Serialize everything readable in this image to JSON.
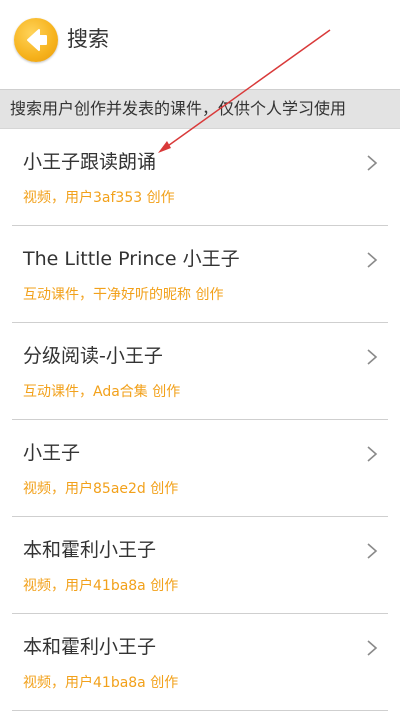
{
  "header": {
    "title": "搜索",
    "back_icon": "back-arrow-icon",
    "accent_color": "#f6b21c"
  },
  "notice": {
    "text": "搜索用户创作并发表的课件，仅供个人学习使用"
  },
  "results": [
    {
      "title": "小王子跟读朗诵",
      "subtitle": "视频，用户3af353 创作"
    },
    {
      "title": "The  Little Prince  小王子",
      "subtitle": "互动课件，干净好听的昵称 创作"
    },
    {
      "title": "分级阅读-小王子",
      "subtitle": "互动课件，Ada合集 创作"
    },
    {
      "title": "小王子",
      "subtitle": "视频，用户85ae2d 创作"
    },
    {
      "title": "本和霍利小王子",
      "subtitle": "视频，用户41ba8a 创作"
    },
    {
      "title": "本和霍利小王子",
      "subtitle": "视频，用户41ba8a 创作"
    }
  ],
  "colors": {
    "subtitle": "#f2a11b",
    "annotation_arrow": "#d93a3a"
  }
}
